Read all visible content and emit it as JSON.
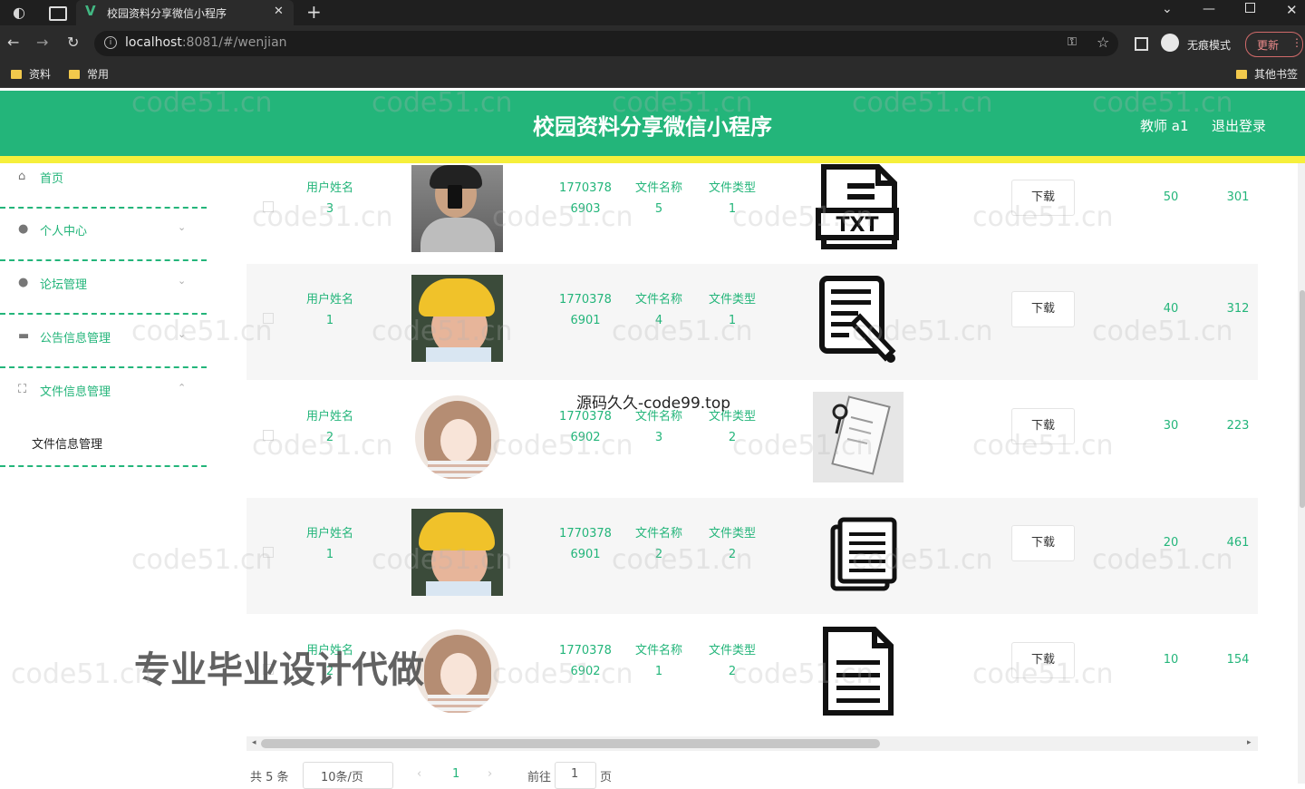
{
  "browser": {
    "tab_title": "校园资料分享微信小程序",
    "url_host": "localhost",
    "url_rest": ":8081/#/wenjian",
    "incognito_label": "无痕模式",
    "update_label": "更新",
    "bookmarks": [
      "资料",
      "常用"
    ],
    "other_bookmarks": "其他书签"
  },
  "header": {
    "title": "校园资料分享微信小程序",
    "user": "教师 a1",
    "logout": "退出登录"
  },
  "sidebar": {
    "items": [
      {
        "label": "首页",
        "icon": "home-icon"
      },
      {
        "label": "个人中心",
        "icon": "user-icon"
      },
      {
        "label": "论坛管理",
        "icon": "user-icon"
      },
      {
        "label": "公告信息管理",
        "icon": "briefcase-icon"
      },
      {
        "label": "文件信息管理",
        "icon": "expand-icon"
      }
    ],
    "sub_item": "文件信息管理"
  },
  "rows": [
    {
      "name_label": "用户姓名",
      "name_val": "3",
      "phone_a": "1770378",
      "phone_b": "6903",
      "file_label": "文件名称",
      "file_val": "5",
      "type_label": "文件类型",
      "type_val": "1",
      "file_icon": "txt-file-icon",
      "download": "下载",
      "num_a": "50",
      "num_b": "301"
    },
    {
      "name_label": "用户姓名",
      "name_val": "1",
      "phone_a": "1770378",
      "phone_b": "6901",
      "file_label": "文件名称",
      "file_val": "4",
      "type_label": "文件类型",
      "type_val": "1",
      "file_icon": "edit-document-icon",
      "download": "下载",
      "num_a": "40",
      "num_b": "312"
    },
    {
      "name_label": "用户姓名",
      "name_val": "2",
      "phone_a": "1770378",
      "phone_b": "6902",
      "file_label": "文件名称",
      "file_val": "3",
      "type_label": "文件类型",
      "type_val": "2",
      "file_icon": "paper-photo-icon",
      "download": "下载",
      "num_a": "30",
      "num_b": "223"
    },
    {
      "name_label": "用户姓名",
      "name_val": "1",
      "phone_a": "1770378",
      "phone_b": "6901",
      "file_label": "文件名称",
      "file_val": "2",
      "type_label": "文件类型",
      "type_val": "2",
      "file_icon": "documents-icon",
      "download": "下载",
      "num_a": "20",
      "num_b": "461"
    },
    {
      "name_label": "用户姓名",
      "name_val": "2",
      "phone_a": "1770378",
      "phone_b": "6902",
      "file_label": "文件名称",
      "file_val": "1",
      "type_label": "文件类型",
      "type_val": "2",
      "file_icon": "document-icon",
      "download": "下载",
      "num_a": "10",
      "num_b": "154"
    }
  ],
  "pagination": {
    "total": "共 5 条",
    "page_size": "10条/页",
    "current": "1",
    "goto_label": "前往",
    "goto_value": "1",
    "page_unit": "页"
  },
  "overlays": {
    "code_text": "源码久久-code99.top",
    "promo_text": "专业毕业设计代做",
    "watermark": "code51.cn"
  },
  "colors": {
    "accent": "#23b57a",
    "header_stripe": "#f6ef3b"
  }
}
